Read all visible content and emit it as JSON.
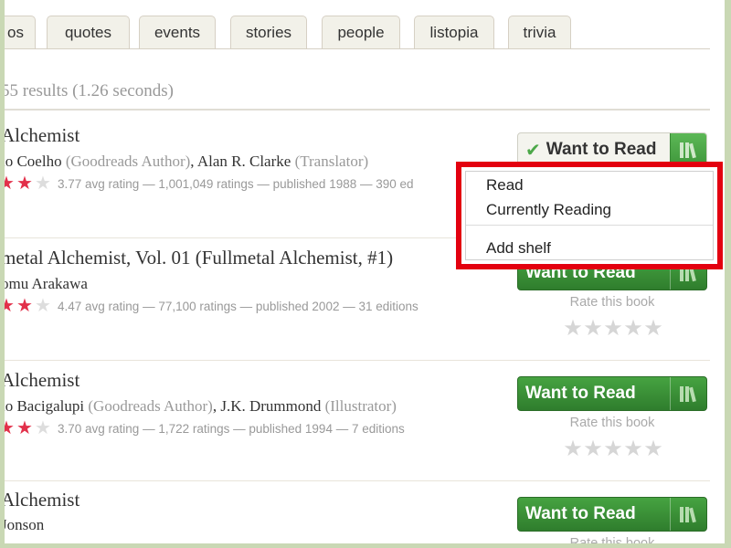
{
  "tabs": [
    {
      "label": "os"
    },
    {
      "label": "quotes"
    },
    {
      "label": "events"
    },
    {
      "label": "stories"
    },
    {
      "label": "people"
    },
    {
      "label": "listopia"
    },
    {
      "label": "trivia"
    }
  ],
  "results_summary": "55 results (1.26 seconds)",
  "books": [
    {
      "title": "Alchemist",
      "authors": [
        {
          "name": "lo Coelho",
          "role": " (Goodreads Author)",
          "sep": ", "
        },
        {
          "name": "Alan R. Clarke",
          "role": " (Translator)",
          "sep": ""
        }
      ],
      "meta": "3.77 avg rating — 1,001,049 ratings — published 1988 — 390 ed",
      "stars_full": 2,
      "stars_empty": 1,
      "button": "Want to Read",
      "rate_label": ""
    },
    {
      "title": "metal Alchemist, Vol. 01 (Fullmetal Alchemist, #1)",
      "authors": [
        {
          "name": "omu Arakawa",
          "role": "",
          "sep": ""
        }
      ],
      "meta": "4.47 avg rating — 77,100 ratings — published 2002 — 31 editions",
      "stars_full": 2,
      "stars_empty": 1,
      "button": "Want to Read",
      "rate_label": "Rate this book"
    },
    {
      "title": "Alchemist",
      "authors": [
        {
          "name": "lo Bacigalupi",
          "role": " (Goodreads Author)",
          "sep": ", "
        },
        {
          "name": "J.K. Drummond",
          "role": " (Illustrator)",
          "sep": ""
        }
      ],
      "meta": "3.70 avg rating — 1,722 ratings — published 1994 — 7 editions",
      "stars_full": 2,
      "stars_empty": 1,
      "button": "Want to Read",
      "rate_label": "Rate this book"
    },
    {
      "title": "Alchemist",
      "authors": [
        {
          "name": "Jonson",
          "role": "",
          "sep": ""
        }
      ],
      "meta": "",
      "stars_full": 0,
      "stars_empty": 0,
      "button": "Want to Read",
      "rate_label": "Rate this book"
    }
  ],
  "dropdown": {
    "items": [
      "Read",
      "Currently Reading",
      "Add shelf"
    ]
  },
  "colors": {
    "accent_green": "#3a8f36",
    "highlight_red": "#e3000f",
    "star_red": "#e2304a"
  }
}
